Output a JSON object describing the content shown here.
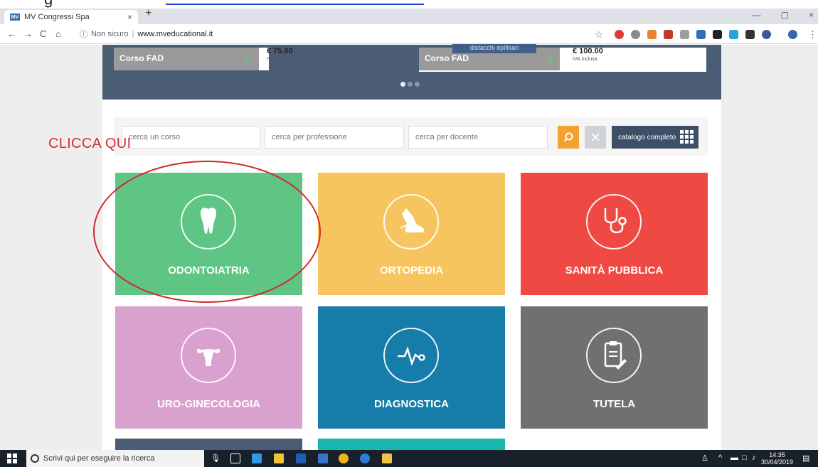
{
  "browser": {
    "tab_title": "MV Congressi Spa",
    "tab_favicon": "MV",
    "tab_close": "×",
    "new_tab": "+",
    "security_label": "Non sicuro",
    "url": "www.mveducational.it",
    "window_controls": [
      "—",
      "▢",
      "×"
    ]
  },
  "top_doc": {
    "fragment": "g"
  },
  "carousel": {
    "cards": [
      {
        "label": "Corso FAD",
        "price": "€ 75.00",
        "tax_note": "IVA Inclusa"
      },
      {
        "label": "Corso FAD",
        "price": "€ 100.00",
        "tax_note": "IVA Inclusa"
      }
    ],
    "overlay_text": "distacchi epifisari"
  },
  "search": {
    "course_placeholder": "cerca un corso",
    "profession_placeholder": "cerca per professione",
    "teacher_placeholder": "cerca per docente",
    "catalog_label": "catalogo completo"
  },
  "annotation": {
    "text": "CLICCA QUI"
  },
  "categories": [
    {
      "label": "ODONTOIATRIA",
      "color": "#5ec585",
      "icon": "tooth-icon"
    },
    {
      "label": "ORTOPEDIA",
      "color": "#f7c560",
      "icon": "leg-icon"
    },
    {
      "label": "SANITÀ PUBBLICA",
      "color": "#ee4a43",
      "icon": "stethoscope-icon"
    },
    {
      "label": "URO-GINECOLOGIA",
      "color": "#d9a1cd",
      "icon": "uterus-icon"
    },
    {
      "label": "DIAGNOSTICA",
      "color": "#167ca9",
      "icon": "heartbeat-icon"
    },
    {
      "label": "TUTELA",
      "color": "#707070",
      "icon": "clipboard-icon"
    }
  ],
  "taskbar": {
    "search_text": "Scrivi qui per eseguire la ricerca",
    "time": "14:35",
    "date": "30/04/2019"
  }
}
